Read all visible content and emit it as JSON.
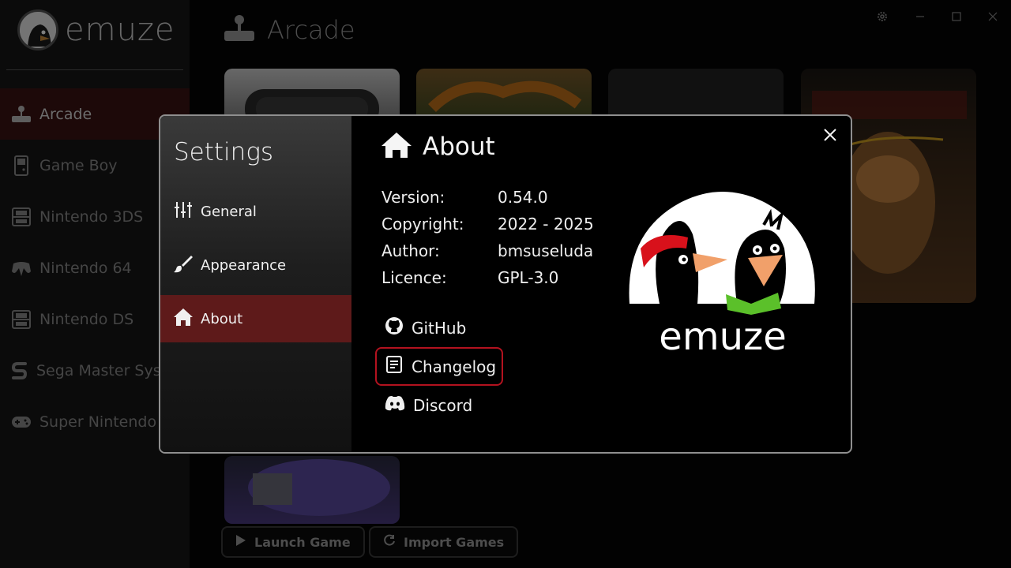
{
  "app": {
    "name": "emuze"
  },
  "sidebar": {
    "items": [
      {
        "label": "Arcade",
        "icon": "joystick-icon",
        "active": true
      },
      {
        "label": "Game Boy",
        "icon": "gameboy-icon"
      },
      {
        "label": "Nintendo 3DS",
        "icon": "ds-icon"
      },
      {
        "label": "Nintendo 64",
        "icon": "n64-controller-icon"
      },
      {
        "label": "Nintendo DS",
        "icon": "ds-icon"
      },
      {
        "label": "Sega Master System",
        "icon": "sega-icon"
      },
      {
        "label": "Super Nintendo Entertainment System",
        "icon": "gamepad-icon"
      }
    ]
  },
  "main": {
    "title": "Arcade",
    "buttons": {
      "launch": "Launch Game",
      "import": "Import Games"
    }
  },
  "settings": {
    "title": "Settings",
    "nav": [
      {
        "label": "General",
        "icon": "sliders-icon"
      },
      {
        "label": "Appearance",
        "icon": "paintbrush-icon"
      },
      {
        "label": "About",
        "icon": "home-icon",
        "active": true
      }
    ],
    "about": {
      "heading": "About",
      "rows": [
        {
          "key": "Version:",
          "value": "0.54.0"
        },
        {
          "key": "Copyright:",
          "value": "2022 - 2025"
        },
        {
          "key": "Author:",
          "value": "bmsuseluda"
        },
        {
          "key": "Licence:",
          "value": "GPL-3.0"
        }
      ],
      "links": [
        {
          "label": "GitHub",
          "icon": "github-icon"
        },
        {
          "label": "Changelog",
          "icon": "document-icon",
          "focused": true
        },
        {
          "label": "Discord",
          "icon": "discord-icon"
        }
      ],
      "logo_text": "emuze"
    }
  },
  "colors": {
    "accent": "#5e1a1a",
    "focus_border": "#b3121f",
    "sidebar_active": "#3a1313"
  }
}
